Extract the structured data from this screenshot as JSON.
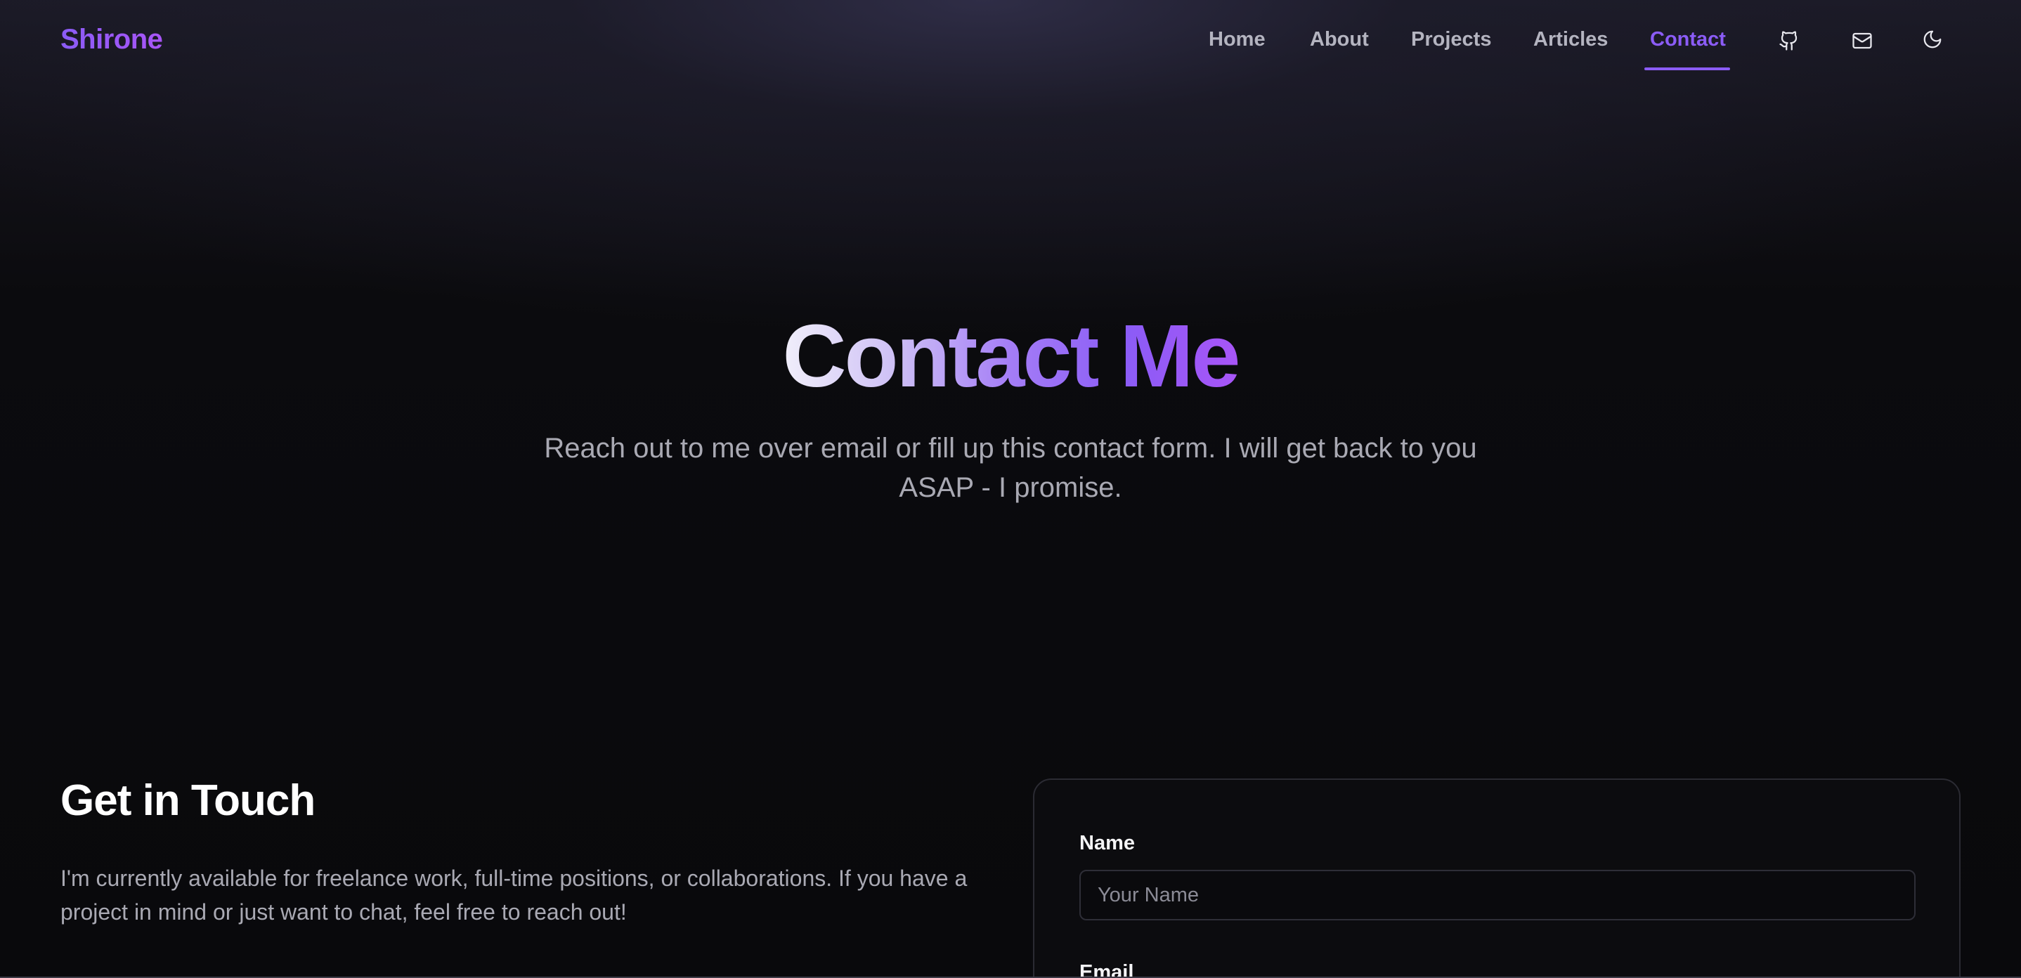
{
  "brand": "Shirone",
  "nav": {
    "items": [
      {
        "label": "Home"
      },
      {
        "label": "About"
      },
      {
        "label": "Projects"
      },
      {
        "label": "Articles"
      },
      {
        "label": "Contact",
        "active": true
      }
    ],
    "icons": [
      "github-icon",
      "mail-icon",
      "moon-icon"
    ]
  },
  "hero": {
    "title": "Contact Me",
    "subtitle": "Reach out to me over email or fill up this contact form. I will get back to you ASAP - I promise."
  },
  "touch": {
    "title": "Get in Touch",
    "text": "I'm currently available for freelance work, full-time positions, or collaborations. If you have a project in mind or just want to chat, feel free to reach out!"
  },
  "form": {
    "name_label": "Name",
    "name_placeholder": "Your Name",
    "email_label": "Email"
  },
  "colors": {
    "accent": "#8b5cf6",
    "background": "#0a0a0d",
    "muted_text": "#a9a9b3"
  }
}
